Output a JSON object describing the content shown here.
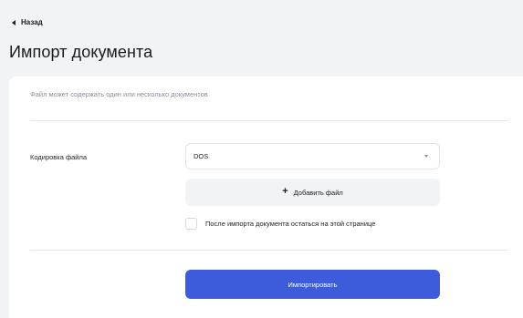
{
  "nav": {
    "back_label": "Назад"
  },
  "header": {
    "title": "Импорт документа"
  },
  "form": {
    "hint": "Файл может содержать один или несколько документов",
    "encoding_label": "Кодировка файла",
    "encoding_value": "DOS",
    "add_file_label": "Добавить файл",
    "stay_on_page_label": "После импорта документа остаться на этой странице",
    "stay_on_page_checked": false,
    "import_button_label": "Импортировать"
  },
  "colors": {
    "page_background": "#f2f3f5",
    "card_background": "#ffffff",
    "primary_button": "#3d5cdb",
    "hint_text": "#8a8f98"
  }
}
